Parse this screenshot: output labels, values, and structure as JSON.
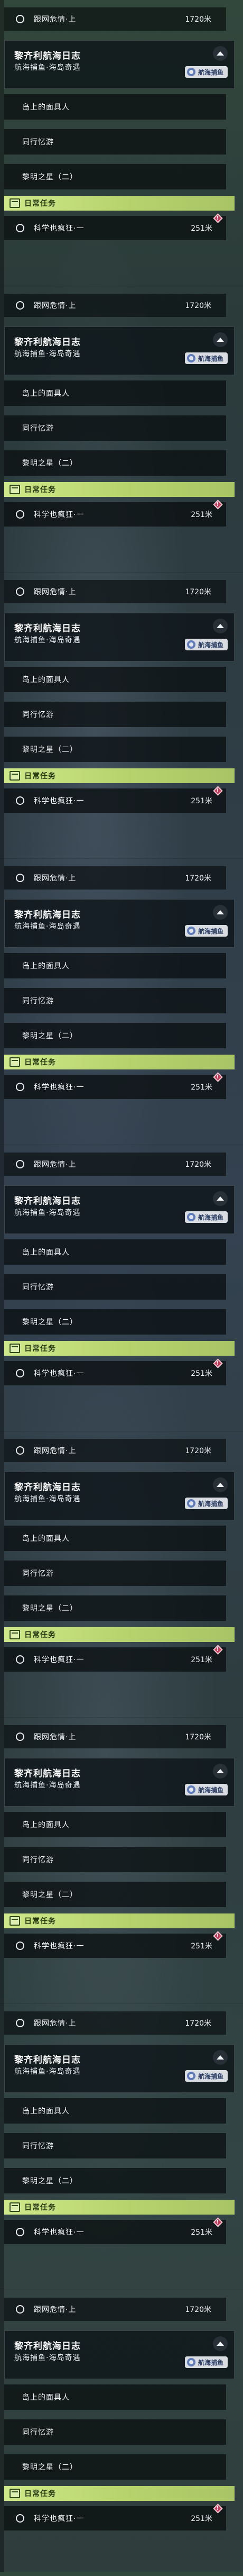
{
  "hint_task": {
    "label": "跟网危情·上",
    "distance": "1720米"
  },
  "quest": {
    "title": "黎齐利航海日志",
    "subtitle": "航海捕鱼·海岛奇遇",
    "badge": "航海捕鱼",
    "steps": [
      {
        "label": "岛上的面具人"
      },
      {
        "label": "同行忆游"
      },
      {
        "label": "黎明之星（二）"
      }
    ]
  },
  "daily": {
    "header": "日常任务",
    "task": {
      "label": "科学也疯狂·一",
      "distance": "251米"
    },
    "alert": "!"
  },
  "colors": {
    "daily_accent": "#cfe88a",
    "badge_bg": "#d9dde2",
    "alert": "#c73a5a"
  },
  "icons": [
    "circle-icon",
    "chevron-up-icon",
    "region-badge-icon",
    "calendar-icon",
    "alert-icon"
  ]
}
